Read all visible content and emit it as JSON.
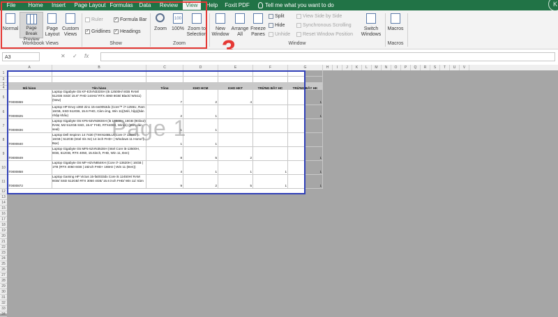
{
  "menu": {
    "items": [
      "File",
      "Home",
      "Insert",
      "Page Layout",
      "Formulas",
      "Data",
      "Review",
      "View",
      "Help",
      "Foxit PDF"
    ],
    "active": "View",
    "tell_me": "Tell me what you want to do"
  },
  "ribbon": {
    "workbook_views": {
      "label": "Workbook Views",
      "normal": "Normal",
      "page_break_preview": "Page Break Preview",
      "page_layout": "Page Layout",
      "custom_views": "Custom Views"
    },
    "show": {
      "label": "Show",
      "ruler": "Ruler",
      "formula_bar": "Formula Bar",
      "gridlines": "Gridlines",
      "headings": "Headings"
    },
    "zoom": {
      "label": "Zoom",
      "zoom": "Zoom",
      "zoom_100": "100%",
      "zoom_to_selection": "Zoom to Selection"
    },
    "window": {
      "label": "Window",
      "new_window": "New Window",
      "arrange_all": "Arrange All",
      "freeze_panes": "Freeze Panes",
      "split": "Split",
      "hide": "Hide",
      "unhide": "Unhide",
      "view_side_by_side": "View Side by Side",
      "synchronous_scrolling": "Synchronous Scrolling",
      "reset_window_position": "Reset Window Position",
      "switch_windows": "Switch Windows"
    },
    "macros": {
      "label": "Macros",
      "macros": "Macros"
    }
  },
  "annotation": {
    "step": "3",
    "color": "#e53935"
  },
  "formula_bar": {
    "name_box": "A3",
    "cancel": "✕",
    "enter": "✓",
    "fx": "fx"
  },
  "grid": {
    "columns": [
      "A",
      "B",
      "C",
      "D",
      "E",
      "F",
      "G",
      "H",
      "I",
      "J",
      "K",
      "L",
      "M",
      "N",
      "O",
      "P",
      "Q",
      "R",
      "S",
      "T",
      "U",
      "V"
    ],
    "rows": [
      "1",
      "2",
      "3",
      "4",
      "5",
      "6",
      "7",
      "8",
      "9",
      "10",
      "11",
      "12",
      "13",
      "14",
      "15",
      "16",
      "17",
      "18",
      "19",
      "20",
      "21",
      "22",
      "23",
      "24",
      "25",
      "26",
      "27",
      "28",
      "29",
      "30",
      "31",
      "32",
      "33",
      "34",
      "35",
      "36",
      "37",
      "38",
      "39",
      "40"
    ],
    "watermark": "Page 1",
    "table": {
      "headers": [
        "Mã hàng",
        "Tên hàng",
        "Tổng",
        "KHO HCM",
        "KHO HKT",
        "TRỪNG BẦY HC",
        "TRỪNG BẦY HK"
      ],
      "rows": [
        {
          "code": "LT0000869",
          "name": "Laptop Gigabyte G5 KF-E3VN333SH (i5 12500H/ 8GB RAM/ 512GB SSD/ 15.6\" FHD 144Hz/ RTX 4060 8GB/ Black/ Win11) (New)",
          "total": "7",
          "hcm": "2",
          "hkt": "4",
          "tbhc": "",
          "tbhk": "1"
        },
        {
          "code": "LT0000825",
          "name": "Laptop HP Envy x360 2in1 15-ew0053dx (Core™ i7-1255U, Ram 16GB, SSD 512GB, 15.6 FHD, Cảm ứng, Win 11)(Mới, hộp)(bản nhập khẩu)",
          "total": "2",
          "hcm": "1",
          "hkt": "",
          "tbhc": "",
          "tbhk": "1"
        },
        {
          "code": "LT0000836",
          "name": "Laptop Gigabyte G5 KF5-53VN383SH (i5 13500H, 16GB (8Gbx2) RAM, M2 512GB SSD, 15.6\" FHD, RTX4060, Win11) (Mới, dán seal)",
          "total": "1",
          "hcm": "1",
          "hkt": "",
          "tbhc": "",
          "tbhk": ""
        },
        {
          "code": "LT0000840",
          "name": "Laptop Dell Inspiron 14 7430 (TXKN16BLU (Core i7 1355U | 16GB | 512GB (Intel Iris Xe) 14 inch FHD+ | Windows 11 Home | Bạc)",
          "total": "1",
          "hcm": "1",
          "hkt": "",
          "tbhc": "",
          "tbhk": ""
        },
        {
          "code": "LT0000849",
          "name": "Laptop Gigabyte G5 MF5-52VN353SH (Intel Core i5-13500H, 8GB, 512GB, RTX 4050, 15.6inch, FHD, Win 11, Đen)",
          "total": "8",
          "hcm": "5",
          "hkt": "2",
          "tbhc": "",
          "tbhk": "1"
        },
        {
          "code": "LT0000858",
          "name": "Laptop Gigabyte G6 MF-H2VN854KH (Core i7-13620H | 16GB | 1TB (RTX 4050 6GB | 16inch FHD+ 165Hz | Win 11 (Đen))",
          "total": "4",
          "hcm": "1",
          "hkt": "1",
          "tbhc": "1",
          "tbhk": "1"
        },
        {
          "code": "LT0000872",
          "name": "Laptop Gaming HP Victus 15-fa0033dx Core i5 12450H/ RAM 8GB/ SSD 512GB/ RTX 3050 4GB/ 15.6 inch FHD/ Win 11/ Xám",
          "total": "9",
          "hcm": "2",
          "hkt": "5",
          "tbhc": "1",
          "tbhk": "1"
        }
      ]
    }
  },
  "colors": {
    "excel_green": "#217346",
    "page_border": "#2f3fb7",
    "header_fill": "#c9c9c9",
    "backdrop": "#a6a6a6"
  }
}
